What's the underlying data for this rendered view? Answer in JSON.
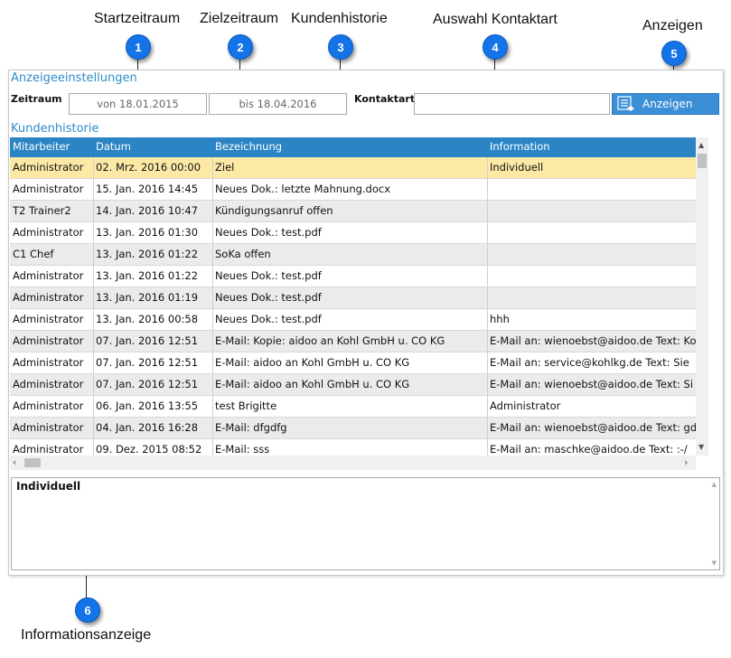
{
  "annotations": [
    {
      "number": "1",
      "label": "Startzeitraum"
    },
    {
      "number": "2",
      "label": "Zielzeitraum"
    },
    {
      "number": "3",
      "label": "Kundenhistorie"
    },
    {
      "number": "4",
      "label": "Auswahl Kontaktart"
    },
    {
      "number": "5",
      "label": "Anzeigen"
    },
    {
      "number": "6",
      "label": "Informationsanzeige"
    }
  ],
  "settings": {
    "title": "Anzeigeeinstellungen",
    "zeitraum_label": "Zeitraum",
    "von_value": "von 18.01.2015",
    "bis_value": "bis 18.04.2016",
    "kontaktart_label": "Kontaktart",
    "kontaktart_value": "",
    "anzeigen_button": "Anzeigen"
  },
  "history": {
    "title": "Kundenhistorie",
    "columns": [
      "Mitarbeiter",
      "Datum",
      "Bezeichnung",
      "Information"
    ],
    "rows": [
      [
        "Administrator",
        "02. Mrz. 2016 00:00",
        "Ziel",
        "Individuell"
      ],
      [
        "Administrator",
        "15. Jan. 2016 14:45",
        "Neues Dok.: letzte Mahnung.docx",
        ""
      ],
      [
        "T2 Trainer2",
        "14. Jan. 2016 10:47",
        "Kündigungsanruf offen",
        ""
      ],
      [
        "Administrator",
        "13. Jan. 2016 01:30",
        "Neues Dok.: test.pdf",
        ""
      ],
      [
        "C1 Chef",
        "13. Jan. 2016 01:22",
        "SoKa offen",
        ""
      ],
      [
        "Administrator",
        "13. Jan. 2016 01:22",
        "Neues Dok.: test.pdf",
        ""
      ],
      [
        "Administrator",
        "13. Jan. 2016 01:19",
        "Neues Dok.: test.pdf",
        ""
      ],
      [
        "Administrator",
        "13. Jan. 2016 00:58",
        "Neues Dok.: test.pdf",
        "hhh"
      ],
      [
        "Administrator",
        "07. Jan. 2016 12:51",
        "E-Mail: Kopie: aidoo an Kohl GmbH u. CO KG",
        "E-Mail an: wienoebst@aidoo.de Text: Ko"
      ],
      [
        "Administrator",
        "07. Jan. 2016 12:51",
        "E-Mail: aidoo an Kohl GmbH u. CO KG",
        "E-Mail an: service@kohlkg.de Text: Sie"
      ],
      [
        "Administrator",
        "07. Jan. 2016 12:51",
        "E-Mail: aidoo an Kohl GmbH u. CO KG",
        "E-Mail an: wienoebst@aidoo.de Text: Si"
      ],
      [
        "Administrator",
        "06. Jan. 2016 13:55",
        "test Brigitte",
        "Administrator"
      ],
      [
        "Administrator",
        "04. Jan. 2016 16:28",
        "E-Mail: dfgdfg",
        "E-Mail an: wienoebst@aidoo.de Text: gd"
      ],
      [
        "Administrator",
        "09. Dez. 2015 08:52",
        "E-Mail: sss",
        "E-Mail an: maschke@aidoo.de Text: :-/"
      ]
    ]
  },
  "info": {
    "text": "Individuell"
  },
  "colors": {
    "accent": "#2b85c5",
    "badge": "#1473e6",
    "selected_row": "#fde9a6",
    "alt_row": "#ebebeb",
    "section_title": "#2e8bc9"
  },
  "icons": [
    "list-icon",
    "scroll-up-icon",
    "scroll-down-icon",
    "scroll-left-icon",
    "scroll-right-icon"
  ]
}
